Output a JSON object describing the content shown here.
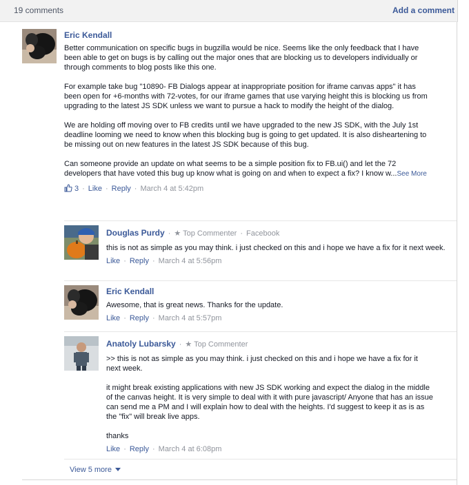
{
  "header": {
    "comment_count": "19 comments",
    "add_comment": "Add a comment"
  },
  "comments": [
    {
      "author": "Eric Kendall",
      "paragraphs": [
        "Better communication on specific bugs in bugzilla would be nice. Seems like the only feedback that I have been able to get on bugs is by calling out the major ones that are blocking us to developers individually or through comments to blog posts like this one.",
        "For example take bug \"10890- FB Dialogs appear at inappropriate position for iframe canvas apps\" it has been open for +6-months with 72-votes, for our iframe games that use varying height this is blocking us from upgrading to the latest JS SDK unless we want to pursue a hack to modify the height of the dialog.",
        "We are holding off moving over to FB credits until we have upgraded to the new JS SDK, with the July 1st deadline looming we need to know when this blocking bug is going to get updated. It is also disheartening to be missing out on new features in the latest JS SDK because of this bug.",
        "Can someone provide an update on what seems to be a simple position fix to FB.ui() and let the 72 developers that have voted this bug up know what is going on and when to expect a fix? I know w..."
      ],
      "see_more": "See More",
      "like_count": "3",
      "like": "Like",
      "reply": "Reply",
      "timestamp": "March 4 at 5:42pm"
    }
  ],
  "replies": [
    {
      "author": "Douglas Purdy",
      "badge": "Top Commenter",
      "affiliation": "Facebook",
      "paragraphs": [
        "this is not as simple as you may think. i just checked on this and i hope we have a fix for it next week."
      ],
      "like": "Like",
      "reply": "Reply",
      "timestamp": "March 4 at 5:56pm"
    },
    {
      "author": "Eric Kendall",
      "paragraphs": [
        "Awesome, that is great news. Thanks for the update."
      ],
      "like": "Like",
      "reply": "Reply",
      "timestamp": "March 4 at 5:57pm"
    },
    {
      "author": "Anatoly Lubarsky",
      "badge": "Top Commenter",
      "paragraphs": [
        ">> this is not as simple as you may think. i just checked on this and i hope we have a fix for it next week.",
        "it might break existing applications with new JS SDK working and expect the dialog in the middle of the canvas height. It is very simple to deal with it with pure javascript/ Anyone that has an issue can send me a PM and I will explain how to deal with the heights. I'd suggest to keep it as is as the \"fix\" will break live apps.",
        "thanks"
      ],
      "like": "Like",
      "reply": "Reply",
      "timestamp": "March 4 at 6:08pm"
    }
  ],
  "view_more": "View 5 more",
  "colors": {
    "link": "#3b5998",
    "meta": "#90949c",
    "text": "#141823"
  }
}
